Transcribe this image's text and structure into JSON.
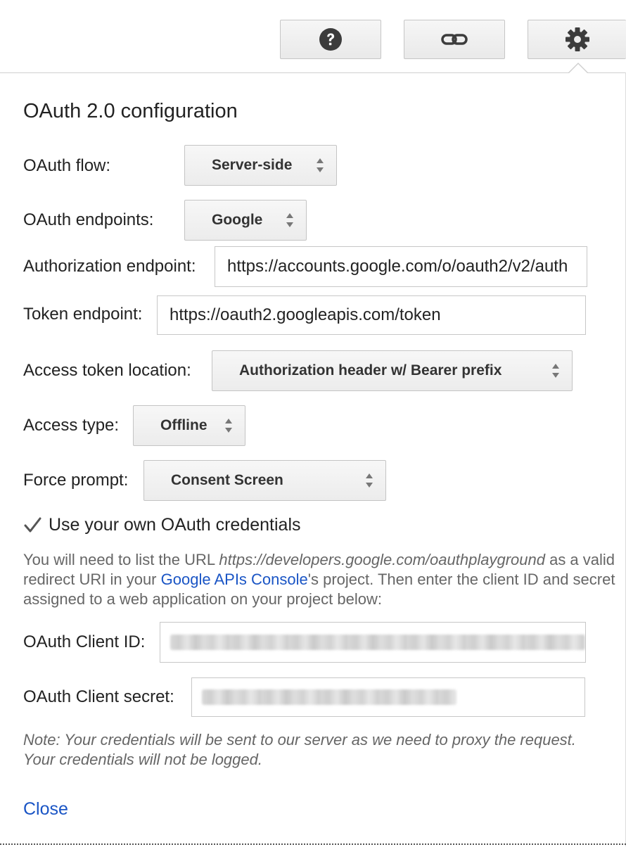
{
  "toolbar": {
    "help_icon": "question-circle-icon",
    "link_icon": "link-icon",
    "settings_icon": "gear-icon"
  },
  "panel": {
    "title": "OAuth 2.0 configuration",
    "oauth_flow": {
      "label": "OAuth flow:",
      "value": "Server-side"
    },
    "oauth_endpoints": {
      "label": "OAuth endpoints:",
      "value": "Google"
    },
    "authorization_endpoint": {
      "label": "Authorization endpoint:",
      "value": "https://accounts.google.com/o/oauth2/v2/auth"
    },
    "token_endpoint": {
      "label": "Token endpoint:",
      "value": "https://oauth2.googleapis.com/token"
    },
    "access_token_location": {
      "label": "Access token location:",
      "value": "Authorization header w/ Bearer prefix"
    },
    "access_type": {
      "label": "Access type:",
      "value": "Offline"
    },
    "force_prompt": {
      "label": "Force prompt:",
      "value": "Consent Screen"
    },
    "own_credentials": {
      "label": "Use your own OAuth credentials",
      "checked": true
    },
    "instructions": {
      "part1": "You will need to list the URL ",
      "url": "https://developers.google.com/oauthplayground",
      "part2": " as a valid redirect URI in your ",
      "console_link": "Google APIs Console",
      "part3": "'s project. Then enter the client ID and secret assigned to a web application on your project below:"
    },
    "client_id": {
      "label": "OAuth Client ID:",
      "value": ""
    },
    "client_secret": {
      "label": "OAuth Client secret:",
      "value": ""
    },
    "note": "Note: Your credentials will be sent to our server as we need to proxy the request. Your credentials will not be logged.",
    "close_label": "Close"
  },
  "colors": {
    "link": "#1a55c5",
    "text": "#222222",
    "muted": "#666666"
  }
}
